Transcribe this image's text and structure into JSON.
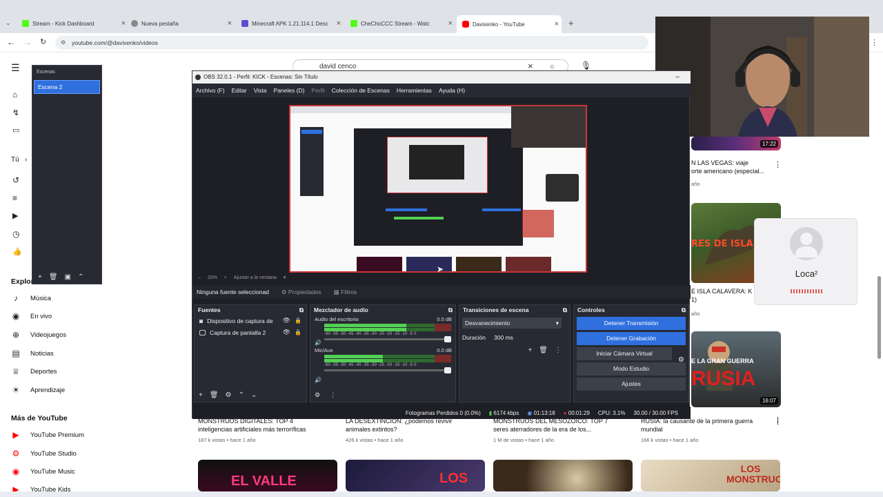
{
  "browser": {
    "tabs": [
      {
        "label": "Stream - Kick Dashboard",
        "color": "#53fc18"
      },
      {
        "label": "Nueva pestaña",
        "color": "#888888"
      },
      {
        "label": "Minecraft APK 1.21.114.1 Desc",
        "color": "#5a4fcf"
      },
      {
        "label": "CheChoCCC Stream - Watc",
        "color": "#53fc18"
      },
      {
        "label": "Davixenko - YouTube",
        "color": "#ff0000"
      }
    ],
    "url": "youtube.com/@davixenko/videos"
  },
  "youtube": {
    "search_value": "david cenco",
    "sidebar": {
      "tu_label": "Tú",
      "explore_label": "Explorar",
      "explore_items": [
        "Música",
        "En vivo",
        "Videojuegos",
        "Noticias",
        "Deportes",
        "Aprendizaje"
      ],
      "more_label": "Más de YouTube",
      "more_items": [
        "YouTube Premium",
        "YouTube Studio",
        "YouTube Music",
        "YouTube Kids"
      ]
    },
    "videos_right": [
      {
        "title": "N LAS VEGAS: viaje",
        "title2": "orte americano (especial...",
        "meta": "año",
        "duration": "17:22"
      },
      {
        "title": "E ISLA CALAVERA: K",
        "title2": "1)",
        "meta": "año",
        "duration": ""
      },
      {
        "title": "",
        "title2": "",
        "meta": "",
        "duration": "16:07"
      }
    ],
    "videos_bottom": [
      {
        "title": "MONSTRUOS DIGITALES: TOP 4",
        "title2": "inteligencias artificiales más terroríficas",
        "meta": "187 k vistas • hace 1 año"
      },
      {
        "title": "LA DESEXTINCIÓN: ¿podemos revivir",
        "title2": "animales extintos?",
        "meta": "426 k vistas • hace 1 año"
      },
      {
        "title": "MONSTRUOS DEL MESOZOICO: TOP 7",
        "title2": "seres aterradores de la era de los...",
        "meta": "1 M de vistas • hace 1 año"
      },
      {
        "title": "RUSIA: la causante de la primera guerra",
        "title2": "mundial",
        "meta": "166 k vistas • hace 1 año"
      }
    ],
    "thumb_texts": [
      "EL VALLE",
      "LOS",
      "LOS MONSTRUOS"
    ],
    "thumb_texts_right": [
      "RES DE ISLA CALAVE",
      "E LA GRAN GUERRA",
      "RUSIA"
    ],
    "call_user": "Loca²"
  },
  "obs": {
    "title": "OBS 32.0.1 - Perfil: KICK - Escenas: Sin Título",
    "menu": [
      "Archivo (F)",
      "Editar",
      "Vista",
      "Paneles (D)",
      "Perfil",
      "Colección de Escenas",
      "Herramientas",
      "Ayuda (H)"
    ],
    "scenes_header": "Escenas",
    "scene_selected": "Escena 2",
    "zoom": "33%",
    "fit_label": "Ajustar a la ventana",
    "no_source": "Ninguna fuente seleccionad",
    "properties": "Propiedades",
    "filters": "Filtros",
    "sources_title": "Fuentes",
    "sources": [
      "Dispositivo de captura de",
      "Captura de pantalla 2"
    ],
    "mixer_title": "Mezclador de audio",
    "mixer": [
      {
        "name": "Audio del escritorio",
        "db": "0.0 dB",
        "level": 0.7
      },
      {
        "name": "Mic/Aux",
        "db": "0.0 dB",
        "level": 0.5
      }
    ],
    "mixer_ticks": "-60 -55 -50 -45 -40 -35 -30 -25 -20 -15 -10 -5 0",
    "transitions_title": "Transiciones de escena",
    "transition": "Desvanecimiento",
    "duration_label": "Duración",
    "duration_value": "300 ms",
    "controls_title": "Controles",
    "controls": [
      "Detener Transmisión",
      "Detener Grabación",
      "Iniciar Cámara Virtual",
      "Modo Estudio",
      "Ajustes"
    ],
    "status": {
      "dropped": "Fotogramas Perdidos 0 (0.0%)",
      "bitrate": "6174 kbps",
      "stream_time": "01:13:18",
      "rec_time": "00:01:29",
      "cpu": "CPU: 3.1%",
      "fps": "30.00 / 30.00 FPS"
    }
  },
  "colors": {
    "obs_bg": "#1e1f25",
    "obs_accent": "#2f6fde",
    "yt_red": "#ff0000"
  }
}
